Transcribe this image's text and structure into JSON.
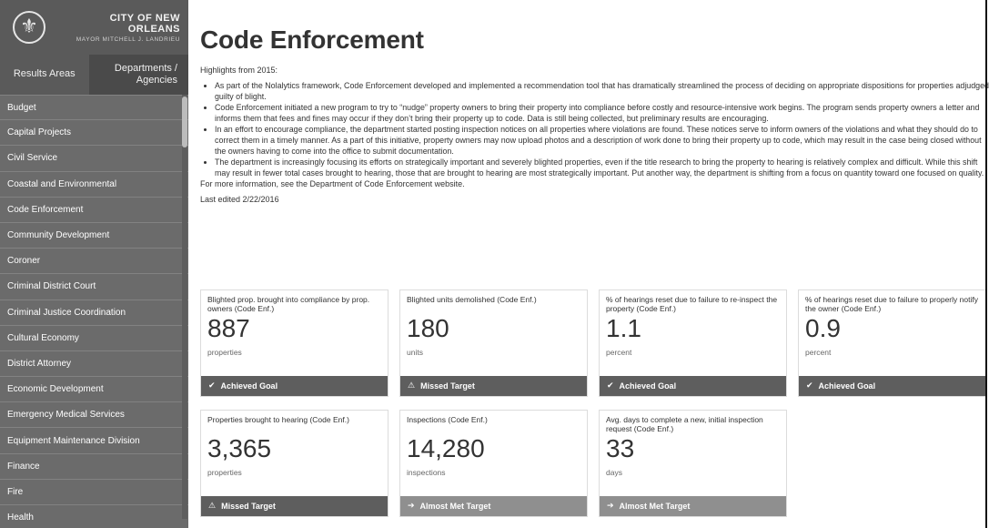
{
  "brand": {
    "city": "CITY OF NEW ORLEANS",
    "mayor": "MAYOR MITCHELL J. LANDRIEU",
    "seal_icon": "fleur-de-lis-icon"
  },
  "tabs": [
    {
      "label": "Results Areas"
    },
    {
      "label": "Departments / Agencies"
    }
  ],
  "nav": [
    "Budget",
    "Capital Projects",
    "Civil Service",
    "Coastal and Environmental",
    "Code Enforcement",
    "Community Development",
    "Coroner",
    "Criminal District Court",
    "Criminal Justice Coordination",
    "Cultural Economy",
    "District Attorney",
    "Economic Development",
    "Emergency Medical Services",
    "Equipment Maintenance Division",
    "Finance",
    "Fire",
    "Health"
  ],
  "page": {
    "title": "Code Enforcement",
    "intro": "Highlights from 2015:",
    "bullets": [
      "As part of the Nolalytics framework, Code Enforcement developed and implemented a recommendation tool that has dramatically streamlined the process of deciding on appropriate dispositions for properties adjudged guilty of blight.",
      "Code Enforcement initiated a new program to try to “nudge” property owners to bring their property into compliance before costly and resource-intensive work begins. The program sends property owners a letter and informs them that fees and fines may occur if they don’t bring their property up to code. Data is still being collected, but preliminary results are encouraging.",
      "In an effort to encourage compliance, the department started posting inspection notices on all properties where violations are found. These notices serve to inform owners of the violations and what they should do to correct them in a timely manner. As a part of this initiative, property owners may now upload photos and a description of work done to bring their property up to code, which may result in the case being closed without the owners having to come into the office to submit documentation.",
      "The department is increasingly focusing its efforts on strategically important and severely blighted properties, even if the title research to bring the property to hearing is relatively complex and difficult. While this shift may result in fewer total cases brought to hearing, those that are brought to hearing are most strategically important. Put another way, the department is shifting from a focus on quantity toward one focused on quality."
    ],
    "more": "For more information, see the Department of Code Enforcement website.",
    "edited": "Last edited 2/22/2016"
  },
  "cards": [
    {
      "label": "Blighted prop. brought into compliance by prop. owners (Code Enf.)",
      "value": "887",
      "unit": "properties",
      "status": "Achieved Goal",
      "status_type": "achieved",
      "status_icon": "check-icon"
    },
    {
      "label": "Blighted units demolished (Code Enf.)",
      "value": "180",
      "unit": "units",
      "status": "Missed Target",
      "status_type": "missed",
      "status_icon": "warning-icon"
    },
    {
      "label": "% of hearings reset due to failure to re-inspect the property (Code Enf.)",
      "value": "1.1",
      "unit": "percent",
      "status": "Achieved Goal",
      "status_type": "achieved",
      "status_icon": "check-icon"
    },
    {
      "label": "% of hearings reset due to failure to properly notify the owner (Code Enf.)",
      "value": "0.9",
      "unit": "percent",
      "status": "Achieved Goal",
      "status_type": "achieved",
      "status_icon": "check-icon"
    },
    {
      "label": "Properties brought to hearing (Code Enf.)",
      "value": "3,365",
      "unit": "properties",
      "status": "Missed Target",
      "status_type": "missed",
      "status_icon": "warning-icon"
    },
    {
      "label": "Inspections (Code Enf.)",
      "value": "14,280",
      "unit": "inspections",
      "status": "Almost Met Target",
      "status_type": "almost",
      "status_icon": "arrow-right-icon"
    },
    {
      "label": "Avg. days to complete a new, initial inspection request (Code Enf.)",
      "value": "33",
      "unit": "days",
      "status": "Almost Met Target",
      "status_type": "almost",
      "status_icon": "arrow-right-icon"
    }
  ]
}
